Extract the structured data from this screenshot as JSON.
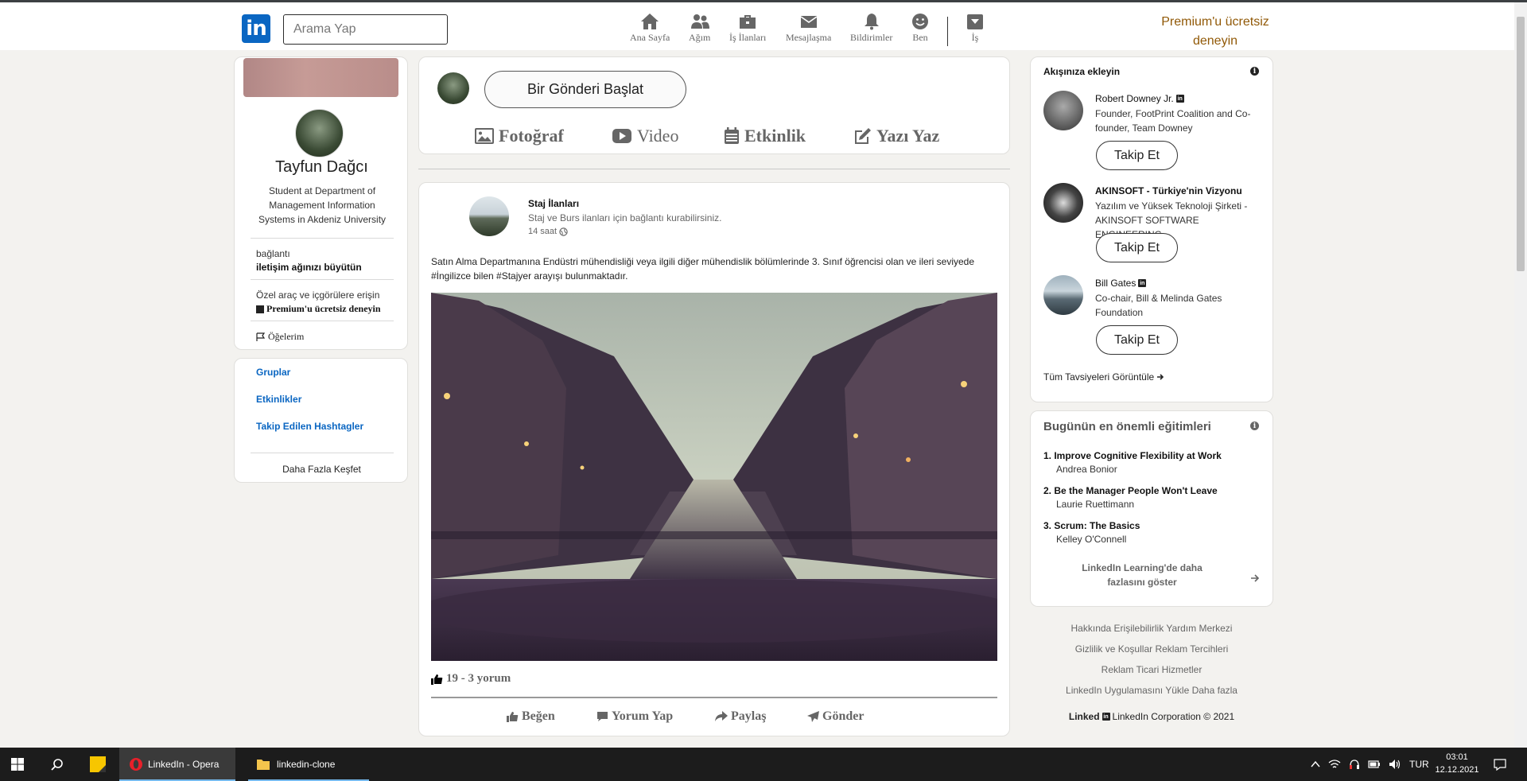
{
  "header": {
    "search_placeholder": "Arama Yap",
    "nav": [
      {
        "label": "Ana Sayfa",
        "icon": "home-icon"
      },
      {
        "label": "Ağım",
        "icon": "network-icon"
      },
      {
        "label": "İş İlanları",
        "icon": "briefcase-icon"
      },
      {
        "label": "Mesajlaşma",
        "icon": "envelope-icon"
      },
      {
        "label": "Bildirimler",
        "icon": "bell-icon"
      },
      {
        "label": "Ben",
        "icon": "smile-icon"
      },
      {
        "label": "İş",
        "icon": "dropdown-box-icon"
      }
    ],
    "premium_line1": "Premium'u ücretsiz",
    "premium_line2": "deneyin"
  },
  "profile": {
    "name": "Tayfun Dağcı",
    "desc": "Student at Department of Management Information Systems in Akdeniz University",
    "conn_label": "bağlantı",
    "conn_cta": "iletişim ağınızı büyütün",
    "tools_label": "Özel araç ve içgörülere erişin",
    "premium_cta": "Premium'u ücretsiz deneyin",
    "items_label": "Öğelerim"
  },
  "left_links": {
    "groups": "Gruplar",
    "events": "Etkinlikler",
    "hashtags": "Takip Edilen Hashtagler",
    "discover": "Daha Fazla Keşfet"
  },
  "share": {
    "start_post": "Bir Gönderi Başlat",
    "photo": "Fotoğraf",
    "video": "Video",
    "event": "Etkinlik",
    "write": "Yazı Yaz"
  },
  "post": {
    "author": "Staj İlanları",
    "subtitle": "Staj ve Burs ilanları için bağlantı kurabilirsiniz.",
    "time": "14 saat",
    "text": "Satın Alma Departmanına Endüstri mühendisliği veya ilgili diğer mühendislik bölümlerinde 3. Sınıf öğrencisi olan ve ileri seviyede #İngilizce bilen #Stajyer arayışı bulunmaktadır.",
    "stats": "19 - 3 yorum",
    "actions": {
      "like": "Beğen",
      "comment": "Yorum Yap",
      "share": "Paylaş",
      "send": "Gönder"
    }
  },
  "follow": {
    "title": "Akışınıza ekleyin",
    "suggestions": [
      {
        "name": "Robert Downey Jr.",
        "desc": "Founder, FootPrint Coalition and Co-founder, Team Downey",
        "button": "Takip Et"
      },
      {
        "name": "AKINSOFT - Türkiye'nin Vizyonu",
        "desc": "Yazılım ve Yüksek Teknoloji Şirketi - AKINSOFT SOFTWARE ENGINEERING",
        "button": "Takip Et"
      },
      {
        "name": "Bill Gates",
        "desc": "Co-chair, Bill & Melinda Gates Foundation",
        "button": "Takip Et"
      }
    ],
    "view_all": "Tüm Tavsiyeleri Görüntüle"
  },
  "learning": {
    "title": "Bugünün en önemli eğitimleri",
    "courses": [
      {
        "title": "1. Improve Cognitive Flexibility at Work",
        "author": "Andrea Bonior"
      },
      {
        "title": "2. Be the Manager People Won't Leave",
        "author": "Laurie Ruettimann"
      },
      {
        "title": "3. Scrum: The Basics",
        "author": "Kelley O'Connell"
      }
    ],
    "more": "LinkedIn Learning'de daha fazlasını göster"
  },
  "footer": {
    "line1": "Hakkında Erişilebilirlik Yardım Merkezi",
    "line2": "Gizlilik ve Koşullar Reklam Tercihleri",
    "line3": "Reklam Ticari Hizmetler",
    "line4": "LinkedIn Uygulamasını Yükle Daha fazla",
    "brand": "Linked",
    "copyright": "LinkedIn Corporation © 2021"
  },
  "taskbar": {
    "app1": "LinkedIn - Opera",
    "app2": "linkedin-clone",
    "lang": "TUR",
    "time": "03:01",
    "date": "12.12.2021"
  },
  "colors": {
    "brand": "#0a66c2",
    "premium": "#915907",
    "background": "#f3f2ef"
  }
}
